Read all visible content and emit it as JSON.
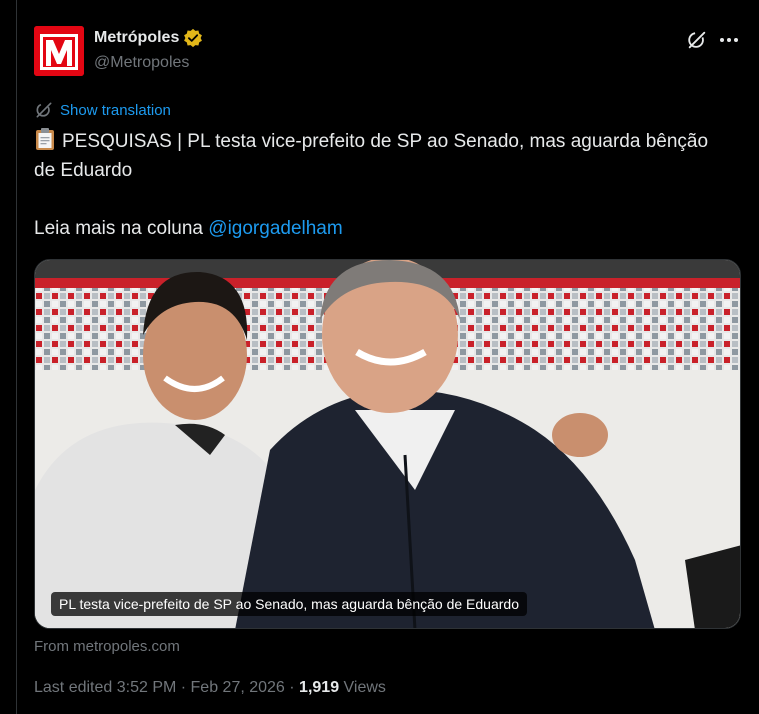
{
  "author": {
    "name": "Metrópoles",
    "handle": "@Metropoles",
    "logo_letter": "M",
    "brand_color": "#e30613",
    "verified_color": "#e2b719"
  },
  "translate_label": "Show translation",
  "tweet": {
    "emoji_icon": "clipboard-icon",
    "line1": "PESQUISAS | PL testa vice-prefeito de SP ao Senado, mas aguarda bênção de Eduardo",
    "line2_prefix": "Leia mais na coluna ",
    "mention": "@igorgadelham"
  },
  "media": {
    "caption": "PL testa vice-prefeito de SP ao Senado, mas aguarda bênção de Eduardo"
  },
  "source_label": "From metropoles.com",
  "meta": {
    "edited": "Last edited 3:52 PM · Feb 27, 2026 · ",
    "views_count": "1,919",
    "views_label": " Views"
  },
  "colors": {
    "background": "#000000",
    "text": "#e7e9ea",
    "secondary": "#71767b",
    "link": "#1d9bf0"
  }
}
